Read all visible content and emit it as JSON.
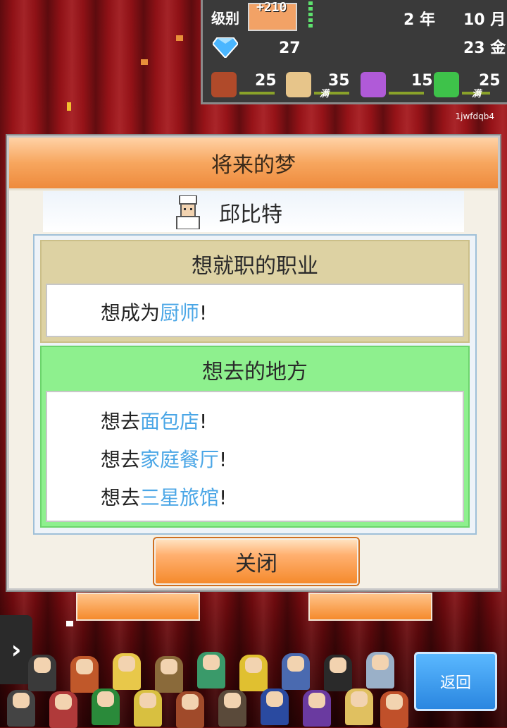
{
  "status": {
    "level_label": "级别",
    "level_gain": "+210",
    "year_value": "2",
    "year_unit": "年",
    "month_value": "10",
    "month_unit": "月",
    "gems": "27",
    "gold_value": "23",
    "gold_unit": "金",
    "resources": [
      {
        "icon": "food-icon",
        "value": "25",
        "full": "",
        "color": "#b04a2a"
      },
      {
        "icon": "bag-icon",
        "value": "35",
        "full": "满",
        "color": "#e7c58a"
      },
      {
        "icon": "music-note-icon",
        "value": "15",
        "full": "",
        "color": "#b05ad8"
      },
      {
        "icon": "book-icon",
        "value": "25",
        "full": "满",
        "color": "#3ec24a"
      }
    ],
    "player_id": "1jwfdqb4"
  },
  "dialog": {
    "title": "将来的梦",
    "character_name": "邱比特",
    "job_section": {
      "heading": "想就职的职业",
      "lines": [
        {
          "prefix": "想成为",
          "highlight": "厨师",
          "suffix": "!"
        }
      ]
    },
    "place_section": {
      "heading": "想去的地方",
      "lines": [
        {
          "prefix": "想去",
          "highlight": "面包店",
          "suffix": "!"
        },
        {
          "prefix": "想去",
          "highlight": "家庭餐厅",
          "suffix": "!"
        },
        {
          "prefix": "想去",
          "highlight": "三星旅馆",
          "suffix": "!"
        }
      ]
    },
    "close_label": "关闭"
  },
  "bottom": {
    "back_label": "返回",
    "arrow_glyph": "›"
  },
  "colors": {
    "accent_orange": "#f58a2c",
    "highlight_blue": "#4aa6e6",
    "place_green": "#8ef08e",
    "job_khaki": "#ddd2a3"
  }
}
